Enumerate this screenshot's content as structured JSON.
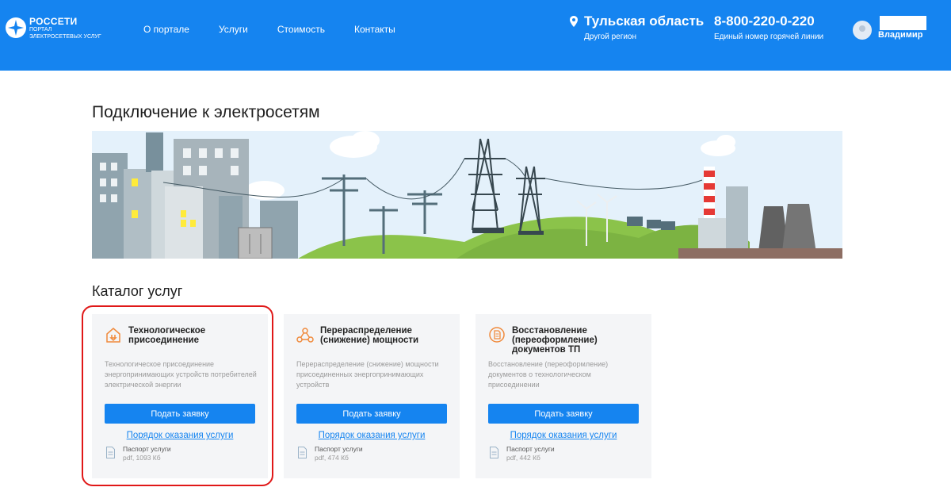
{
  "header": {
    "logo": {
      "brand": "РОССЕТИ",
      "line1": "ПОРТАЛ",
      "line2": "ЭЛЕКТРОСЕТЕВЫХ УСЛУГ"
    },
    "nav": [
      "О портале",
      "Услуги",
      "Стоимость",
      "Контакты"
    ],
    "region": {
      "name": "Тульская область",
      "other": "Другой регион"
    },
    "hotline": {
      "phone": "8-800-220-0-220",
      "caption": "Единый номер горячей линии"
    },
    "user": {
      "name": "Владимир"
    }
  },
  "main": {
    "title": "Подключение к электросетям",
    "catalog_title": "Каталог услуг",
    "cards": [
      {
        "icon": "house-plug-icon",
        "title": "Технологическое присоединение",
        "description": "Технологическое присоединение энергопринимающих устройств потребителей электрической энергии",
        "button": "Подать заявку",
        "link": "Порядок оказания услуги",
        "doc_name": "Паспорт услуги",
        "doc_meta": "pdf, 1093 Кб"
      },
      {
        "icon": "network-nodes-icon",
        "title": "Перераспределение (снижение) мощности",
        "description": "Перераспределение (снижение) мощности присоединенных энергопринимающих устройств",
        "button": "Подать заявку",
        "link": "Порядок оказания услуги",
        "doc_name": "Паспорт услуги",
        "doc_meta": "pdf, 474 Кб"
      },
      {
        "icon": "document-restore-icon",
        "title": "Восстановление (переоформление) документов ТП",
        "description": "Восстановление (переоформление) документов о технологическом присоединении",
        "button": "Подать заявку",
        "link": "Порядок оказания услуги",
        "doc_name": "Паспорт услуги",
        "doc_meta": "pdf, 442 Кб"
      }
    ]
  },
  "colors": {
    "header": "#1584f0",
    "button": "#1584f0",
    "card_bg": "#f4f5f7",
    "highlight": "#e01818",
    "icon_accent": "#f08a3c"
  }
}
